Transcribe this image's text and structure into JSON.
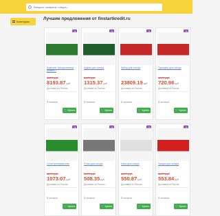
{
  "search": {
    "placeholder": "Введите название товара..."
  },
  "nav": {
    "catalog_label": "Категории"
  },
  "page": {
    "title": "Лучшие предложения от finstartkredit.ru"
  },
  "ui": {
    "buy_label": "Купить"
  },
  "products": [
    {
      "badge": "-%",
      "name": "Комплект тренировочный (бизнес-)",
      "old": "3677 руб",
      "price": "8193.87",
      "unit": "руб",
      "shop": "Доставка по России",
      "meta": "В наличии",
      "accent": "#2b7b2f"
    },
    {
      "badge": "-%",
      "name": "Коврик для гольфа",
      "old": "3677 руб",
      "price": "1315.37",
      "unit": "руб",
      "shop": "Доставка по России",
      "meta": "В наличии",
      "accent": "#1f5d2c"
    },
    {
      "badge": "-%",
      "name": "Набор для гольфа",
      "old": "",
      "price": "23809.19",
      "unit": "руб",
      "shop": "Доставка по России",
      "meta": "В наличии",
      "accent": "#c62828"
    },
    {
      "badge": "-%",
      "name": "Тренажёр для гольфа",
      "old": "3677 руб",
      "price": "720.98",
      "unit": "руб",
      "shop": "Доставка по России",
      "meta": "В наличии",
      "accent": "#c62828"
    },
    {
      "badge": "-%",
      "name": "Сетка тренировочная",
      "old": "3677 руб",
      "price": "1073.07",
      "unit": "руб",
      "shop": "Доставка по России",
      "meta": "В наличии",
      "accent": "#2a8b2f"
    },
    {
      "badge": "-%",
      "name": "Ручка для гольфа",
      "old": "3677 руб",
      "price": "508.35",
      "unit": "руб",
      "shop": "Доставка по России",
      "meta": "В наличии",
      "accent": "#777777"
    },
    {
      "badge": "-%",
      "name": "Мячи для гольфа",
      "old": "3677 руб",
      "price": "550.87",
      "unit": "руб",
      "shop": "Доставка по России",
      "meta": "В наличии",
      "accent": "#e0e0e0"
    },
    {
      "badge": "-%",
      "name": "Прицел для гольфа",
      "old": "3677 руб",
      "price": "553.84",
      "unit": "руб",
      "shop": "Доставка по России",
      "meta": "В наличии",
      "accent": "#d22020"
    }
  ]
}
